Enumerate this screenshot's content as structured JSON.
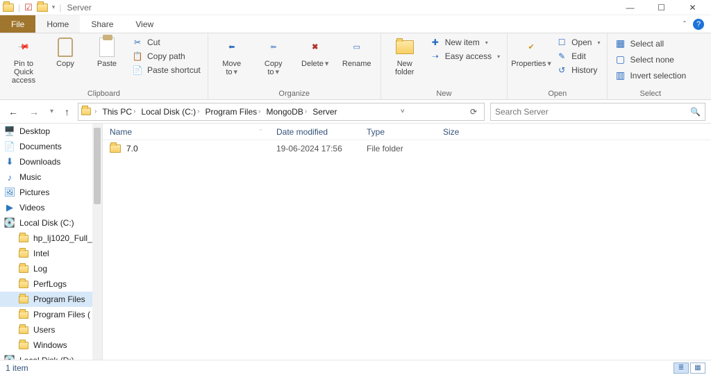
{
  "window": {
    "title": "Server"
  },
  "tabs": {
    "file": "File",
    "home": "Home",
    "share": "Share",
    "view": "View"
  },
  "ribbon": {
    "clipboard": {
      "pin": "Pin to Quick\naccess",
      "copy": "Copy",
      "paste": "Paste",
      "cut": "Cut",
      "copypath": "Copy path",
      "pasteshortcut": "Paste shortcut",
      "label": "Clipboard"
    },
    "organize": {
      "moveto": "Move\nto",
      "copyto": "Copy\nto",
      "delete": "Delete",
      "rename": "Rename",
      "label": "Organize"
    },
    "new": {
      "newfolder": "New\nfolder",
      "newitem": "New item",
      "easyaccess": "Easy access",
      "label": "New"
    },
    "open": {
      "properties": "Properties",
      "open": "Open",
      "edit": "Edit",
      "history": "History",
      "label": "Open"
    },
    "select": {
      "selectall": "Select all",
      "selectnone": "Select none",
      "invert": "Invert selection",
      "label": "Select"
    }
  },
  "breadcrumb": [
    "This PC",
    "Local Disk (C:)",
    "Program Files",
    "MongoDB",
    "Server"
  ],
  "search": {
    "placeholder": "Search Server"
  },
  "tree": [
    {
      "icon": "desktop",
      "label": "Desktop"
    },
    {
      "icon": "doc",
      "label": "Documents"
    },
    {
      "icon": "dl",
      "label": "Downloads"
    },
    {
      "icon": "music",
      "label": "Music"
    },
    {
      "icon": "pic",
      "label": "Pictures"
    },
    {
      "icon": "vid",
      "label": "Videos"
    },
    {
      "icon": "disk",
      "label": "Local Disk (C:)"
    },
    {
      "icon": "folder",
      "label": "hp_lj1020_Full_",
      "indent": 1
    },
    {
      "icon": "folder",
      "label": "Intel",
      "indent": 1
    },
    {
      "icon": "folder",
      "label": "Log",
      "indent": 1
    },
    {
      "icon": "folder",
      "label": "PerfLogs",
      "indent": 1
    },
    {
      "icon": "folder",
      "label": "Program Files",
      "indent": 1,
      "selected": true
    },
    {
      "icon": "folder",
      "label": "Program Files (",
      "indent": 1
    },
    {
      "icon": "folder",
      "label": "Users",
      "indent": 1
    },
    {
      "icon": "folder",
      "label": "Windows",
      "indent": 1
    },
    {
      "icon": "disk",
      "label": "Local Disk (D:)"
    }
  ],
  "columns": {
    "name": "Name",
    "date": "Date modified",
    "type": "Type",
    "size": "Size"
  },
  "rows": [
    {
      "name": "7.0",
      "date": "19-06-2024 17:56",
      "type": "File folder",
      "size": ""
    }
  ],
  "status": {
    "text": "1 item"
  }
}
